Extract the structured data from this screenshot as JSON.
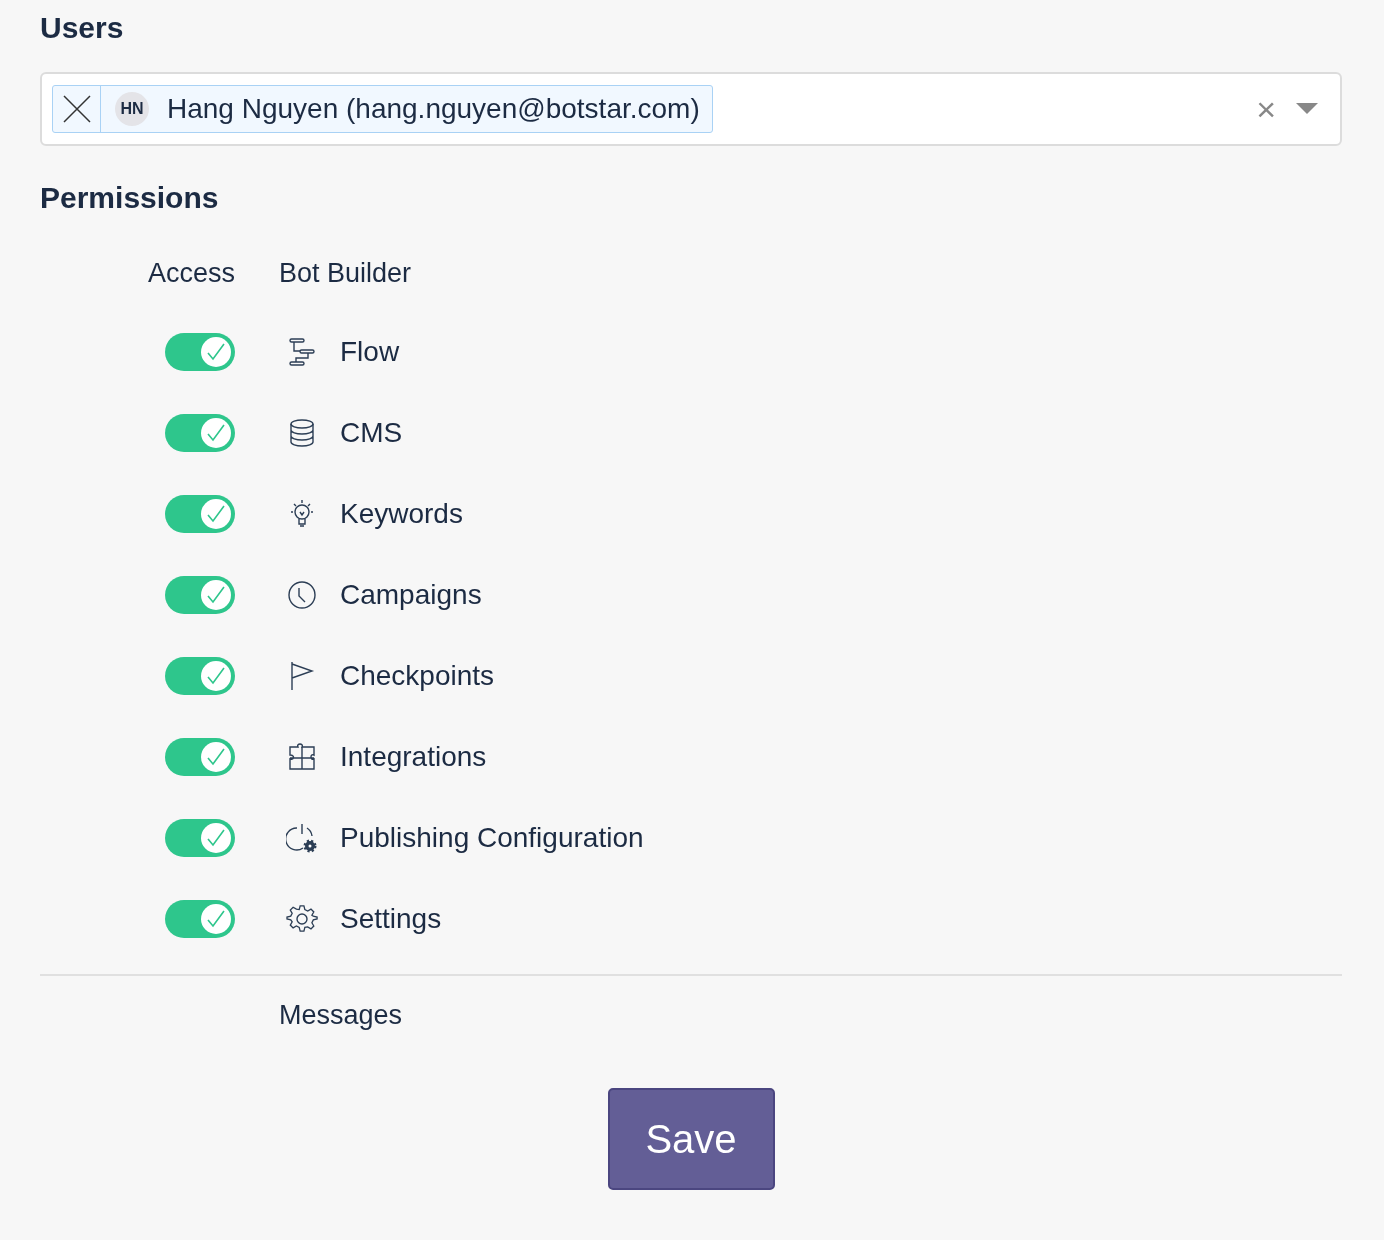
{
  "users": {
    "title": "Users",
    "chips": [
      {
        "initials": "HN",
        "label": "Hang Nguyen (hang.nguyen@botstar.com)"
      }
    ],
    "clear": "×"
  },
  "permissions": {
    "title": "Permissions",
    "access_header": "Access",
    "group_header": "Bot Builder",
    "items": [
      {
        "kind": "flow",
        "label": "Flow",
        "on": true
      },
      {
        "kind": "database",
        "label": "CMS",
        "on": true
      },
      {
        "kind": "bulb",
        "label": "Keywords",
        "on": true
      },
      {
        "kind": "clock",
        "label": "Campaigns",
        "on": true
      },
      {
        "kind": "flag",
        "label": "Checkpoints",
        "on": true
      },
      {
        "kind": "puzzle",
        "label": "Integrations",
        "on": true
      },
      {
        "kind": "power-gear",
        "label": "Publishing Configuration",
        "on": true
      },
      {
        "kind": "gear",
        "label": "Settings",
        "on": true
      }
    ],
    "next_group_header": "Messages"
  },
  "save_button": "Save"
}
